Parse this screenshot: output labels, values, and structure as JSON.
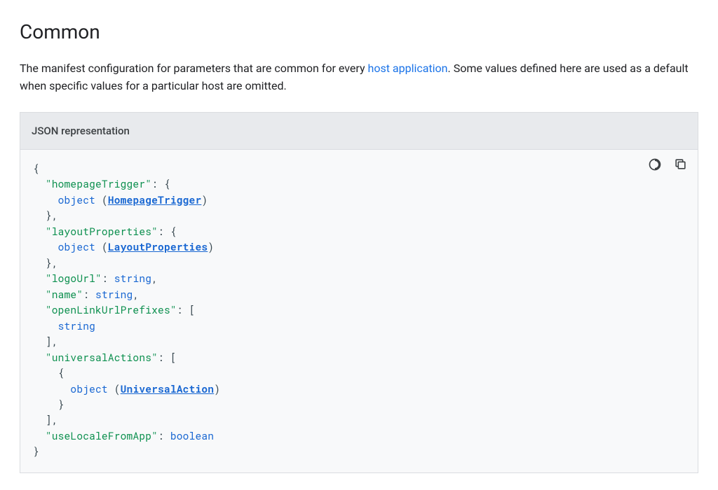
{
  "section": {
    "title": "Common",
    "desc_before": "The manifest configuration for parameters that are common for every ",
    "link_text": "host application",
    "desc_after": ". Some values defined here are used as a default when specific values for a particular host are omitted."
  },
  "card": {
    "header": "JSON representation"
  },
  "code": {
    "open_brace": "{",
    "close_brace": "}",
    "open_bracket": "[",
    "close_bracket": "]",
    "colon": ":",
    "comma": ",",
    "object_kw": "object",
    "paren_open": "(",
    "paren_close": ")",
    "keys": {
      "homepageTrigger": "\"homepageTrigger\"",
      "layoutProperties": "\"layoutProperties\"",
      "logoUrl": "\"logoUrl\"",
      "name": "\"name\"",
      "openLinkUrlPrefixes": "\"openLinkUrlPrefixes\"",
      "universalActions": "\"universalActions\"",
      "useLocaleFromApp": "\"useLocaleFromApp\""
    },
    "types": {
      "string": "string",
      "boolean": "boolean",
      "HomepageTrigger": "HomepageTrigger",
      "LayoutProperties": "LayoutProperties",
      "UniversalAction": "UniversalAction"
    }
  }
}
